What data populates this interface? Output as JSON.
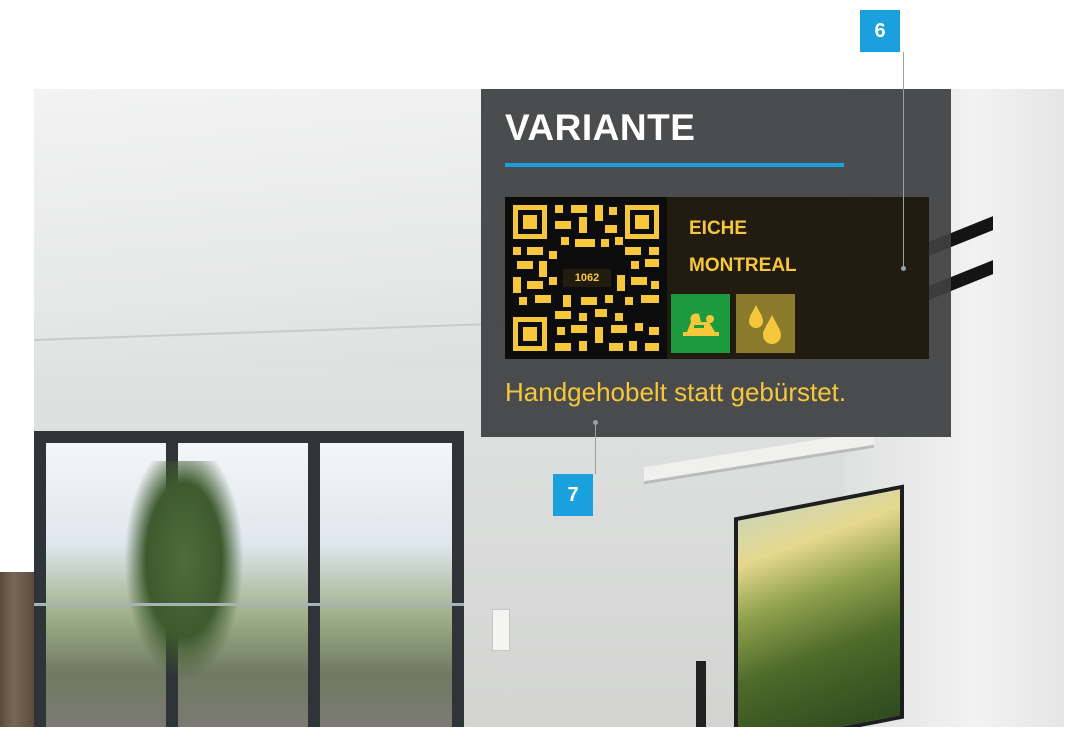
{
  "panel": {
    "title": "VARIANTE",
    "product": {
      "qr_number": "1062",
      "name_line1": "EICHE",
      "name_line2": "MONTREAL",
      "badges": [
        {
          "icon": "hand-plane-icon",
          "color": "#1c9a3e"
        },
        {
          "icon": "oil-drops-icon",
          "color": "#8a7a2c"
        }
      ]
    },
    "caption": "Handgehobelt statt gebürstet."
  },
  "callouts": {
    "six": "6",
    "seven": "7"
  },
  "colors": {
    "accent": "#1aa0dc",
    "text_highlight": "#f6c73a",
    "panel_bg": "#3e4042"
  }
}
